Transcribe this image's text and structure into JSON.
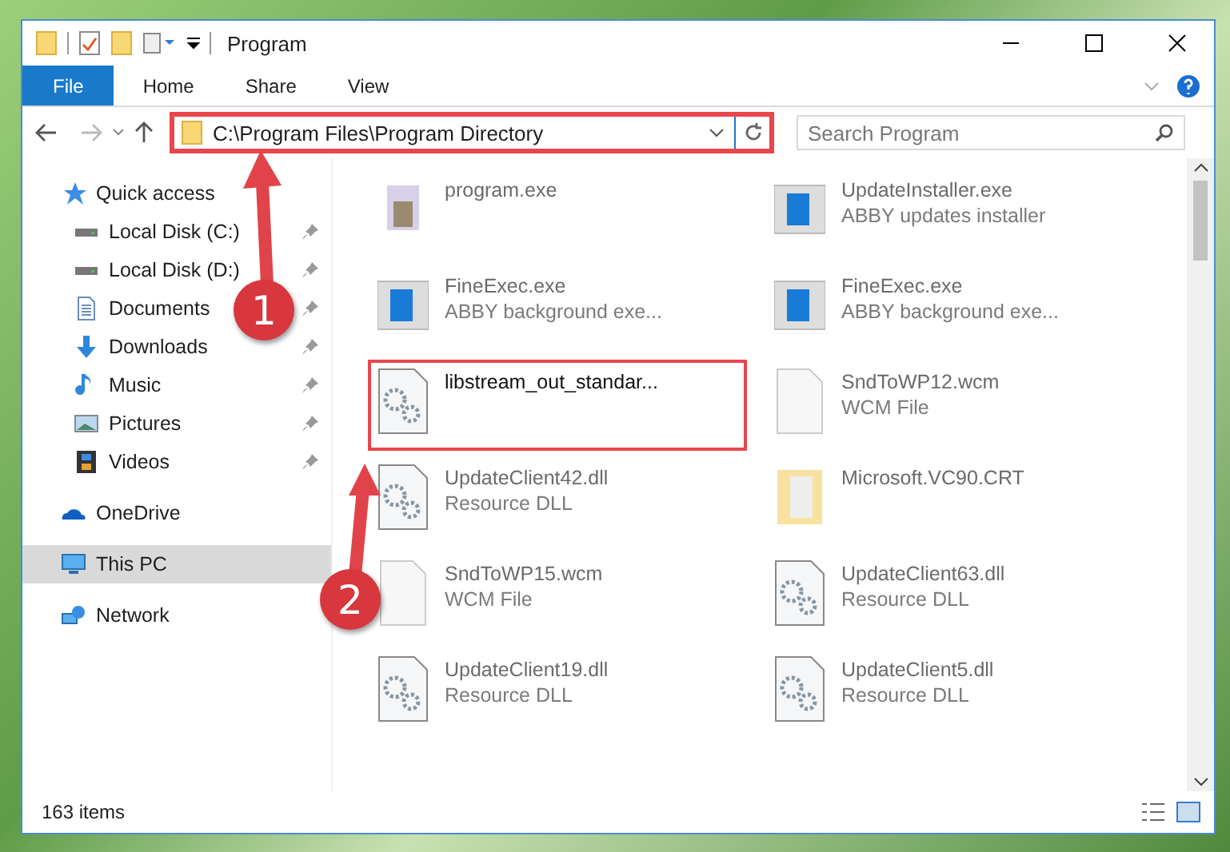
{
  "window": {
    "title": "Program"
  },
  "ribbon_tabs": [
    {
      "label": "File",
      "selected": true
    },
    {
      "label": "Home",
      "selected": false
    },
    {
      "label": "Share",
      "selected": false
    },
    {
      "label": "View",
      "selected": false
    }
  ],
  "address": {
    "value": "C:\\Program Files\\Program Directory",
    "highlighted": true
  },
  "search": {
    "placeholder": "Search Program"
  },
  "sidebar": {
    "items": [
      {
        "label": "Quick access",
        "selected": false,
        "children": [
          {
            "label": "Local Disk (C:)"
          },
          {
            "label": "Local Disk (D:)"
          },
          {
            "label": "Documents"
          },
          {
            "label": "Downloads"
          },
          {
            "label": "Music"
          },
          {
            "label": "Pictures"
          },
          {
            "label": "Videos"
          }
        ]
      },
      {
        "label": "OneDrive",
        "selected": false
      },
      {
        "label": "This PC",
        "selected": true
      },
      {
        "label": "Network",
        "selected": false
      }
    ]
  },
  "files": [
    {
      "name": "program.exe",
      "highlighted": false
    },
    {
      "name": "UpdateInstaller.exe",
      "subtitle": "ABBY updates installer",
      "highlighted": false
    },
    {
      "name": "FineExec.exe",
      "subtitle": "ABBY background exe...",
      "highlighted": false
    },
    {
      "name": "FineExec.exe",
      "subtitle": "ABBY background exe...",
      "highlighted": false
    },
    {
      "name": "libstream_out_standar...",
      "highlighted": true
    },
    {
      "name": "SndToWP12.wcm",
      "subtitle": "WCM File",
      "highlighted": false
    },
    {
      "name": "UpdateClient42.dll",
      "subtitle": "Resource DLL",
      "highlighted": false
    },
    {
      "name": "Microsoft.VC90.CRT",
      "highlighted": false
    },
    {
      "name": "SndToWP15.wcm",
      "subtitle": "WCM File",
      "highlighted": false
    },
    {
      "name": "UpdateClient63.dll",
      "subtitle": "Resource DLL",
      "highlighted": false
    },
    {
      "name": "UpdateClient19.dll",
      "subtitle": "Resource DLL",
      "highlighted": false
    },
    {
      "name": "UpdateClient5.dll",
      "subtitle": "Resource DLL",
      "highlighted": false
    }
  ],
  "status_bar": {
    "count": "163 items"
  },
  "annotations": [
    {
      "number": "1"
    },
    {
      "number": "2"
    }
  ]
}
